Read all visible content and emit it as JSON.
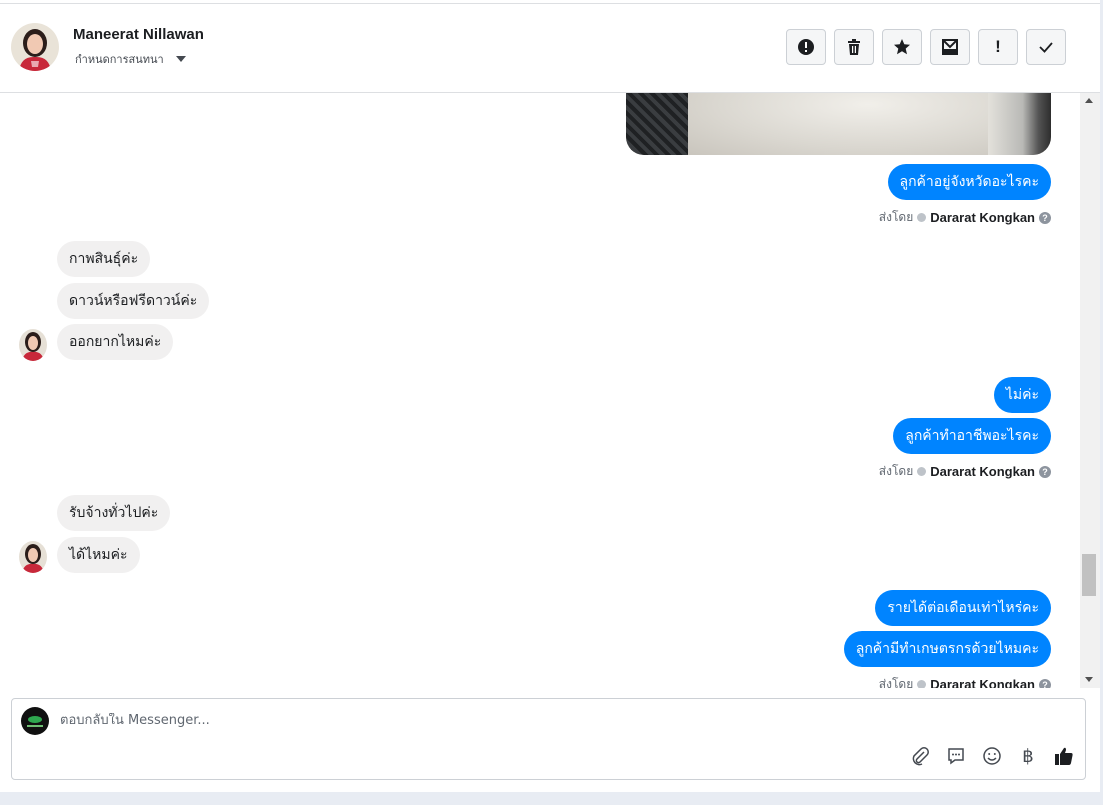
{
  "header": {
    "contact_name": "Maneerat Nillawan",
    "label_text": "กำหนดการสนทนา"
  },
  "actions": [
    {
      "name": "report-button",
      "icon": "alert-circle-icon"
    },
    {
      "name": "delete-button",
      "icon": "trash-icon"
    },
    {
      "name": "star-button",
      "icon": "star-icon"
    },
    {
      "name": "mark-unread-button",
      "icon": "envelope-icon"
    },
    {
      "name": "spam-button",
      "icon": "exclamation-icon"
    },
    {
      "name": "mark-done-button",
      "icon": "check-icon"
    }
  ],
  "messages": {
    "m1": "ลูกค้าอยู่จังหวัดอะไรคะ",
    "m2": "กาพสินธุ์ค่ะ",
    "m3": "ดาวน์หรือฟรีดาวน์ค่ะ",
    "m4": "ออกยากไหมค่ะ",
    "m5": "ไม่ค่ะ",
    "m6": "ลูกค้าทำอาชีพอะไรคะ",
    "m7": "รับจ้างทั่วไปค่ะ",
    "m8": "ได้ไหมค่ะ",
    "m9": "รายได้ต่อเดือนเท่าไหร่คะ",
    "m10": "ลูกค้ามีทำเกษตรกรด้วยไหมคะ"
  },
  "sent_by": {
    "prefix": "ส่งโดย",
    "name": "Dararat Kongkan",
    "help": "?"
  },
  "composer": {
    "placeholder": "ตอบกลับใน Messenger...",
    "baht_symbol": "฿"
  },
  "colors": {
    "outgoing": "#0084ff",
    "incoming": "#f1f0f0",
    "border": "#dddfe2"
  }
}
